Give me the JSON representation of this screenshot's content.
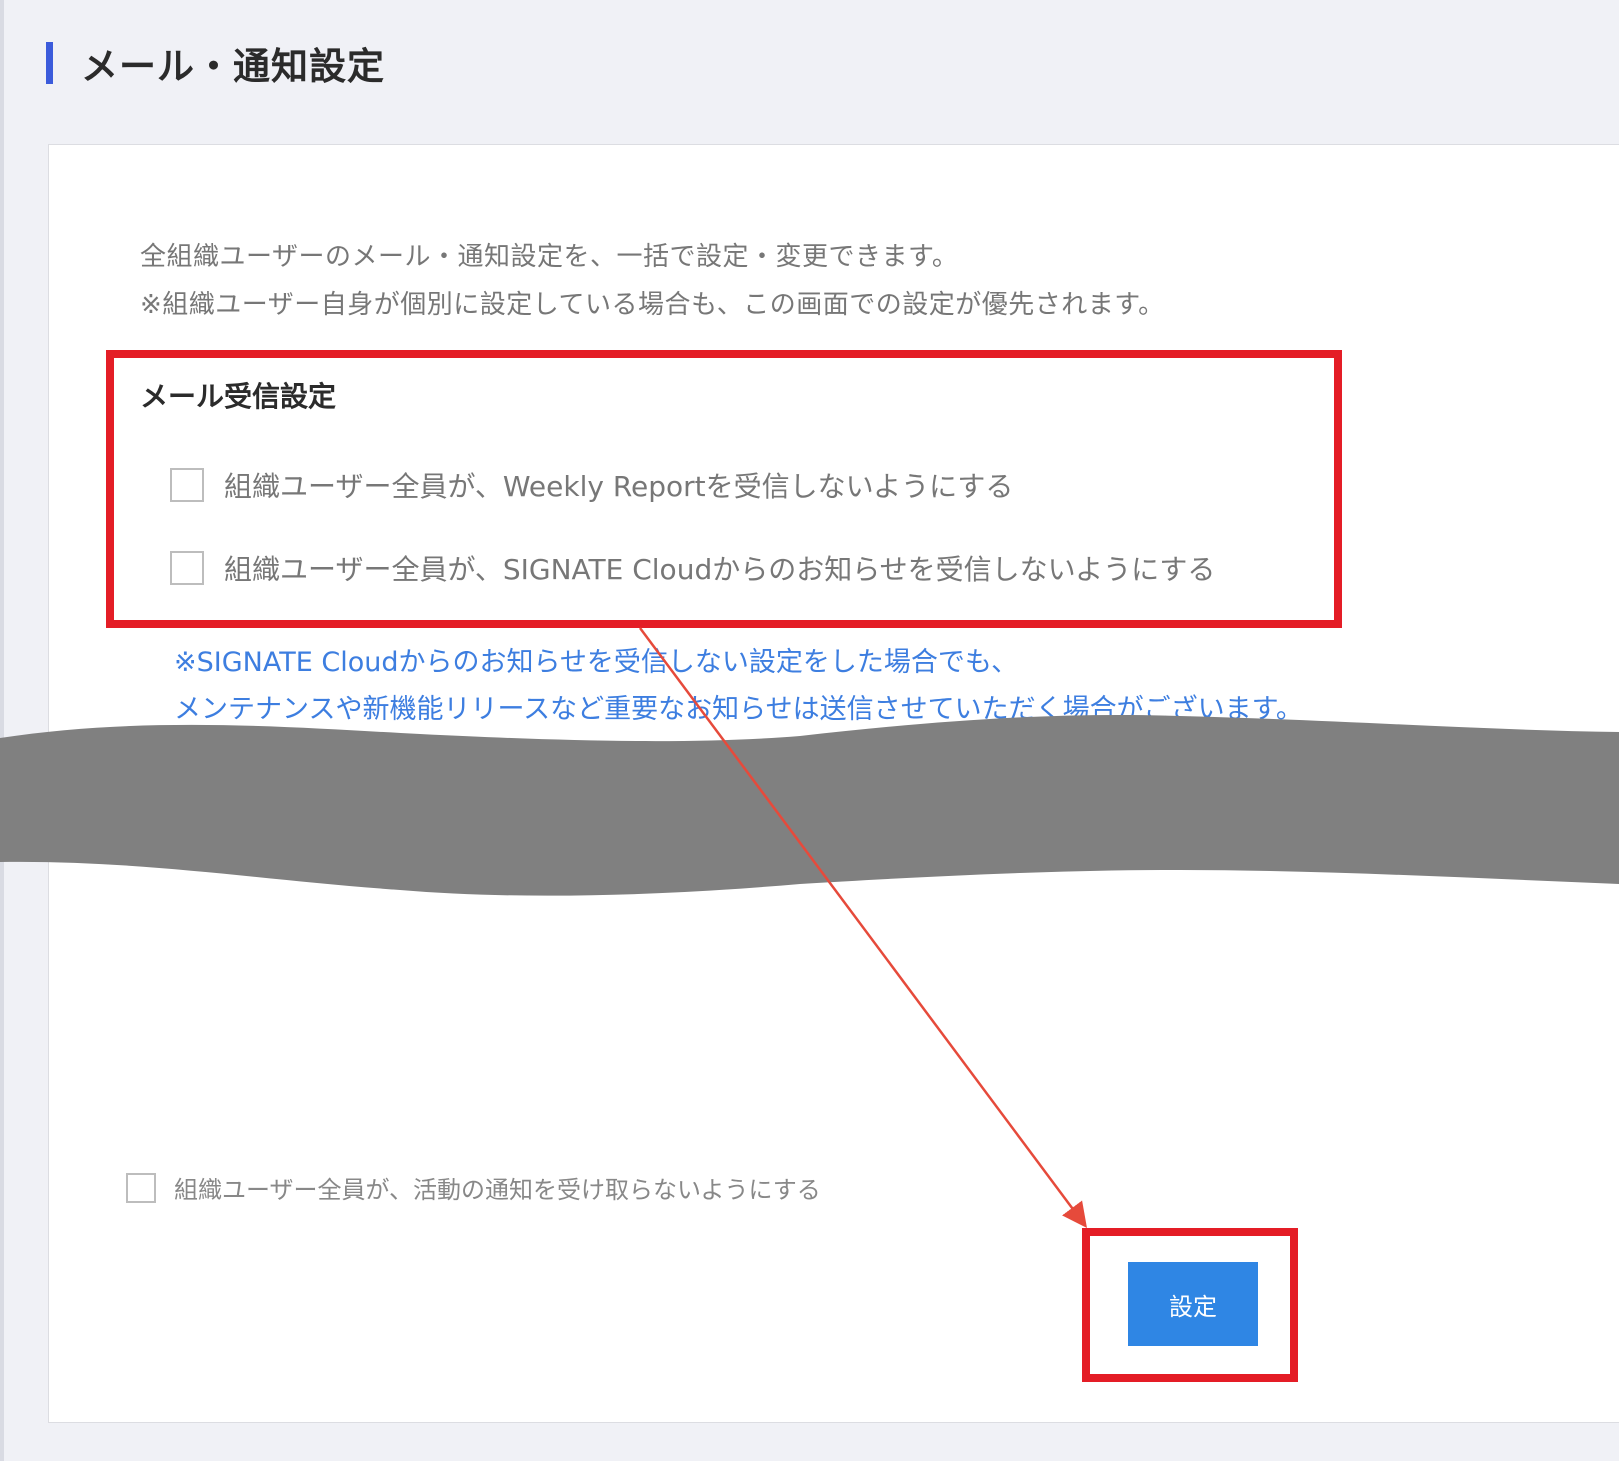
{
  "page": {
    "title": "メール・通知設定"
  },
  "description": {
    "line1": "全組織ユーザーのメール・通知設定を、一括で設定・変更できます。",
    "line2": "※組織ユーザー自身が個別に設定している場合も、この画面での設定が優先されます。"
  },
  "mail_settings": {
    "title": "メール受信設定",
    "options": [
      {
        "label": "組織ユーザー全員が、Weekly Reportを受信しないようにする",
        "checked": false
      },
      {
        "label": "組織ユーザー全員が、SIGNATE Cloudからのお知らせを受信しないようにする",
        "checked": false
      }
    ],
    "note_line1": "※SIGNATE Cloudからのお知らせを受信しない設定をした場合でも、",
    "note_line2": "メンテナンスや新機能リリースなど重要なお知らせは送信させていただく場合がございます。"
  },
  "notification_settings": {
    "option": {
      "label": "組織ユーザー全員が、活動の通知を受け取らないようにする",
      "checked": false
    }
  },
  "actions": {
    "save_label": "設定"
  },
  "colors": {
    "accent_bar": "#3b5bdb",
    "highlight": "#e41d26",
    "button": "#2f86e4",
    "note_text": "#3d7ee0",
    "arrow": "#e64a3b",
    "tear": "#808080"
  }
}
